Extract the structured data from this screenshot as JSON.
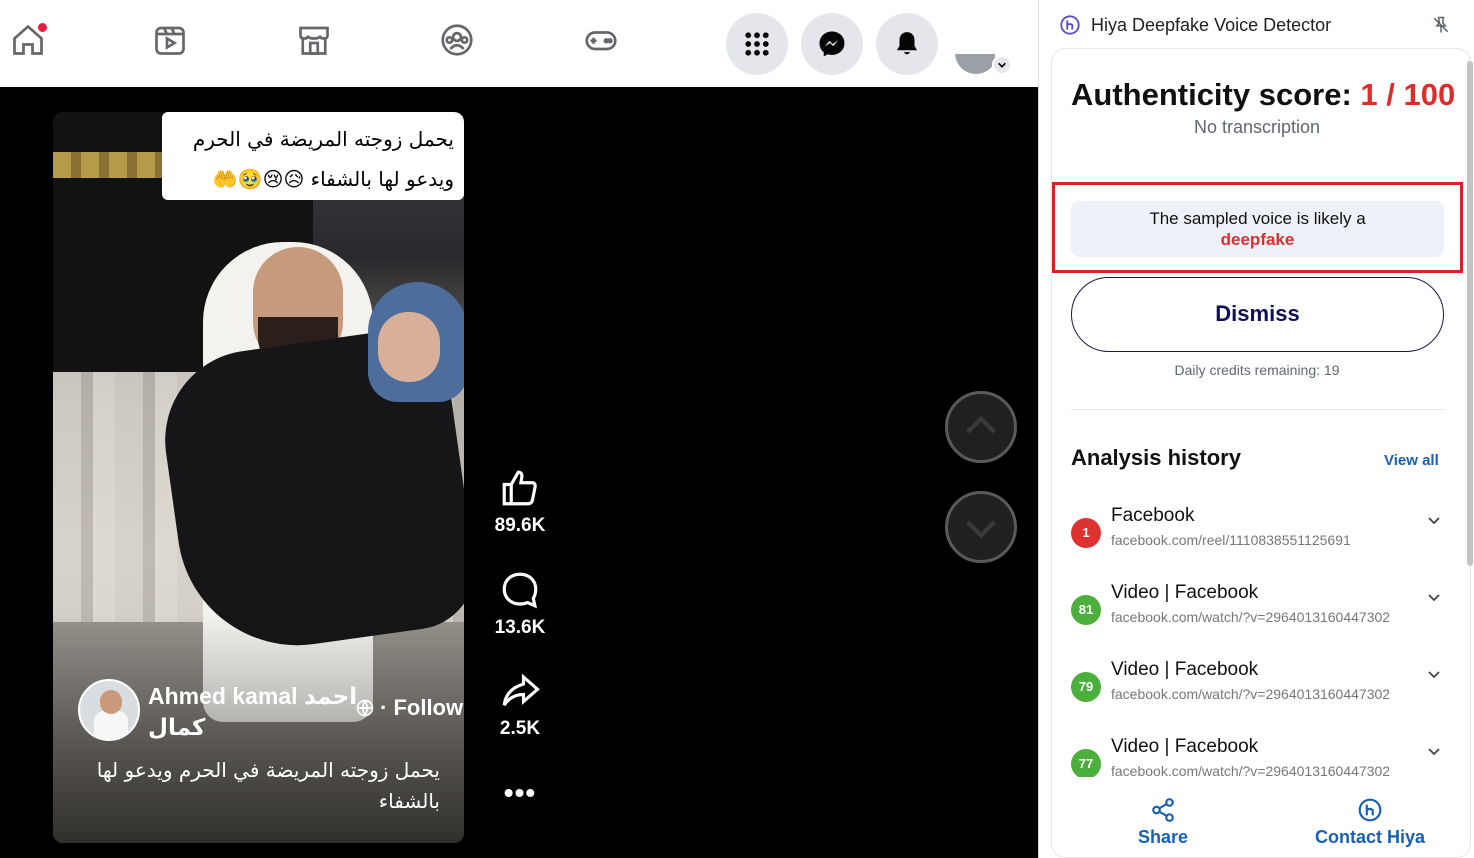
{
  "fb_nav": {
    "icons": [
      "home-icon",
      "video-icon",
      "marketplace-icon",
      "groups-icon",
      "gaming-icon"
    ],
    "circle_buttons": [
      "menu-grid-icon",
      "messenger-icon",
      "notifications-bell-icon"
    ]
  },
  "reel": {
    "caption_overlay_line1": "يحمل زوجته المريضة في الحرم",
    "caption_overlay_line2": "ويدعو لها بالشفاء 😥😢🥹🤲",
    "author_name": "Ahmed kamal احمد كمال",
    "follow_label": "Follow",
    "follow_separator": "·",
    "description": "يحمل زوجته المريضة في الحرم ويدعو لها بالشفاء",
    "likes": "89.6K",
    "comments": "13.6K",
    "shares": "2.5K",
    "more_label": "•••"
  },
  "extension": {
    "title": "Hiya Deepfake Voice Detector",
    "score_label": "Authenticity score:",
    "score_value": "1 / 100",
    "transcription": "No transcription",
    "verdict_line": "The sampled voice is likely a",
    "verdict_word": "deepfake",
    "dismiss_label": "Dismiss",
    "credits": "Daily credits remaining: 19",
    "history_title": "Analysis history",
    "view_all": "View all",
    "history": [
      {
        "score": "1",
        "color": "#e03131",
        "name": "Facebook",
        "url": "facebook.com/reel/1110838551125691"
      },
      {
        "score": "81",
        "color": "#4caf3b",
        "name": "Video | Facebook",
        "url": "facebook.com/watch/?v=2964013160447302"
      },
      {
        "score": "79",
        "color": "#4caf3b",
        "name": "Video | Facebook",
        "url": "facebook.com/watch/?v=2964013160447302"
      },
      {
        "score": "77",
        "color": "#4caf3b",
        "name": "Video | Facebook",
        "url": "facebook.com/watch/?v=2964013160447302"
      }
    ],
    "share_label": "Share",
    "contact_label": "Contact Hiya"
  }
}
